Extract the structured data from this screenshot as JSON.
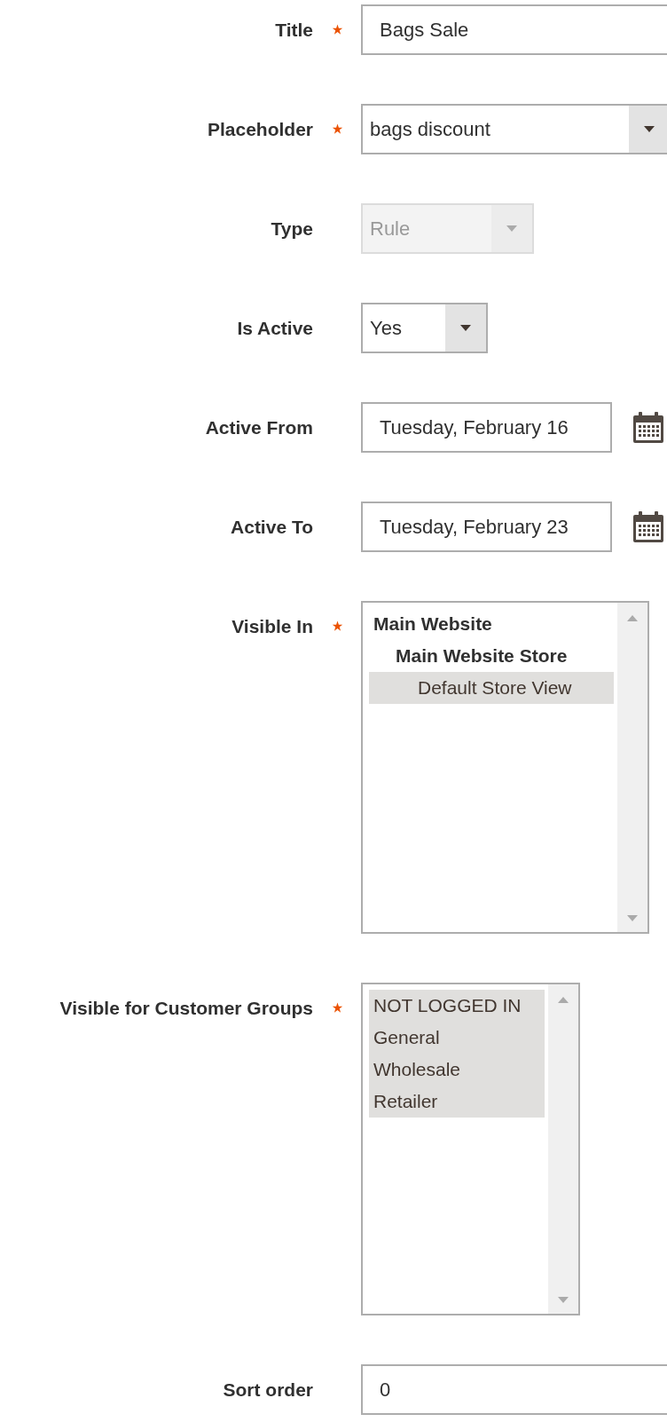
{
  "fields": [
    {
      "kind": "text",
      "label": "Title",
      "required": true,
      "value": "Bags Sale"
    },
    {
      "kind": "select",
      "label": "Placeholder",
      "required": true,
      "value": "bags discount",
      "disabled": false
    },
    {
      "kind": "select",
      "label": "Type",
      "required": false,
      "value": "Rule",
      "disabled": true
    },
    {
      "kind": "select",
      "label": "Is Active",
      "required": false,
      "value": "Yes",
      "disabled": false
    },
    {
      "kind": "date",
      "label": "Active From",
      "required": false,
      "value": "Tuesday, February 16"
    },
    {
      "kind": "date",
      "label": "Active To",
      "required": false,
      "value": "Tuesday, February 23"
    },
    {
      "kind": "multiselect",
      "label": "Visible In",
      "required": true,
      "options": [
        {
          "kind": "group",
          "label": "Main Website",
          "children": [
            {
              "kind": "group",
              "label": "Main Website Store",
              "children": [
                {
                  "kind": "option",
                  "label": "Default Store View",
                  "selected": true
                }
              ]
            }
          ]
        }
      ]
    },
    {
      "kind": "multiselect",
      "label": "Visible for Customer Groups",
      "required": true,
      "options": [
        {
          "kind": "option",
          "label": "NOT LOGGED IN",
          "selected": true
        },
        {
          "kind": "option",
          "label": "General",
          "selected": true
        },
        {
          "kind": "option",
          "label": "Wholesale",
          "selected": true
        },
        {
          "kind": "option",
          "label": "Retailer",
          "selected": true
        }
      ]
    },
    {
      "kind": "text",
      "label": "Sort order",
      "required": false,
      "value": "0"
    }
  ]
}
